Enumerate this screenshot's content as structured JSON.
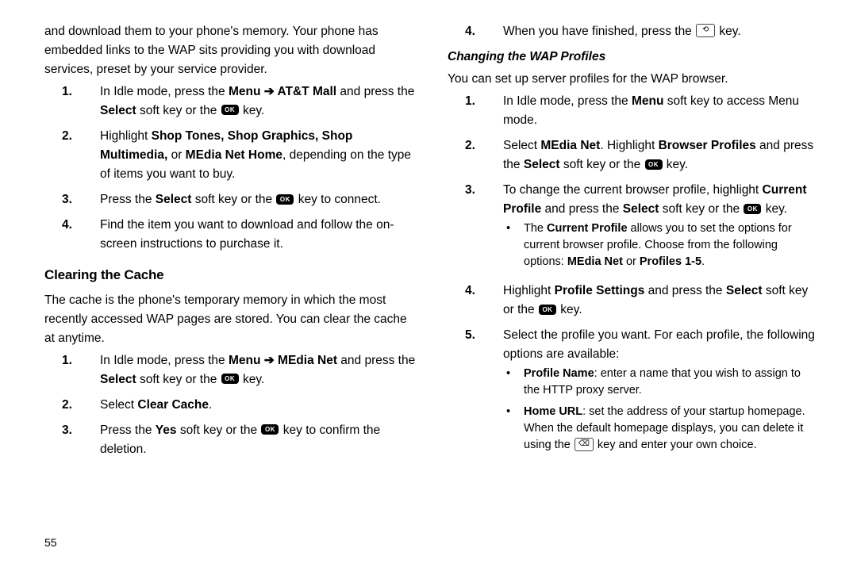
{
  "page_number": "55",
  "left": {
    "intro": "and download them to your phone's memory. Your phone has embedded links to the WAP sits providing you with download services, preset by your service provider.",
    "steps": [
      {
        "num": "1.",
        "html": "In Idle mode, press the <b>Menu ➔ AT&T Mall</b> and press the <b>Select</b> soft key or the <span class='ok-key'>OK</span> key."
      },
      {
        "num": "2.",
        "html": "Highlight <b>Shop Tones, Shop Graphics, Shop Multimedia,</b> or <b>MEdia Net Home</b>, depending on the type of items you want to buy."
      },
      {
        "num": "3.",
        "html": "Press the <b>Select</b> soft key or the <span class='ok-key'>OK</span> key to connect."
      },
      {
        "num": "4.",
        "html": "Find the item you want to download and follow the on-screen instructions to purchase it."
      }
    ],
    "h2": "Clearing the Cache",
    "cache_intro": "The cache is the phone's temporary memory in which the most recently accessed WAP pages are stored. You can clear the cache at anytime.",
    "cache_steps": [
      {
        "num": "1.",
        "html": "In Idle mode, press the <b>Menu ➔ MEdia Net</b> and press the <b>Select</b> soft key or the <span class='ok-key'>OK</span> key."
      },
      {
        "num": "2.",
        "html": "Select <b>Clear Cache</b>."
      },
      {
        "num": "3.",
        "html": "Press the <b>Yes</b> soft key or the <span class='ok-key'>OK</span> key to confirm the deletion."
      }
    ]
  },
  "right": {
    "first_step": {
      "num": "4.",
      "html": "When you have finished, press the <span class='loop-key'>⟲</span> key."
    },
    "h3": "Changing the WAP Profiles",
    "intro": "You can set up server profiles for the WAP browser.",
    "steps": [
      {
        "num": "1.",
        "html": "In Idle mode, press the <b>Menu</b> soft key to access Menu mode."
      },
      {
        "num": "2.",
        "html": "Select <b>MEdia Net</b>. Highlight <b>Browser Profiles</b> and press the <b>Select</b> soft key or the <span class='ok-key'>OK</span> key."
      },
      {
        "num": "3.",
        "html": "To change the current browser profile, highlight <b>Current Profile</b> and press the <b>Select</b> soft key or the <span class='ok-key'>OK</span> key.",
        "bullets": [
          "The <b>Current Profile</b> allows you to set the options for current browser profile. Choose from the following options: <b>MEdia Net</b> or <b>Profiles 1-5</b>."
        ]
      },
      {
        "num": "4.",
        "html": "Highlight <b>Profile Settings</b> and press the <b>Select</b> soft key or the <span class='ok-key'>OK</span> key."
      },
      {
        "num": "5.",
        "html": "Select the profile you want. For each profile, the following options are available:",
        "bullets": [
          "<b>Profile Name</b>: enter a name that you wish to assign to the HTTP proxy server.",
          "<b>Home URL</b>: set the address of your startup homepage. When the default homepage displays, you can delete it using the <span class='loop-key2'>⌫</span> key and enter your own choice."
        ]
      }
    ]
  }
}
